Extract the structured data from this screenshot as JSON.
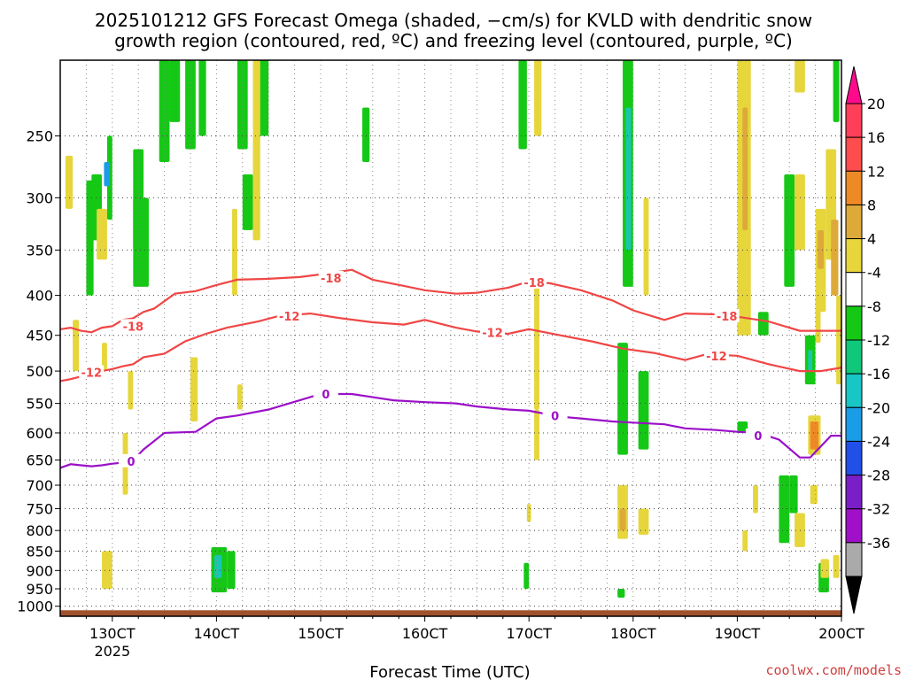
{
  "chart_data": {
    "type": "heatmap",
    "title_lines": [
      "2025101212 GFS Forecast Omega (shaded, −cm/s) for KVLD with dendritic snow",
      "growth region (contoured, red, ºC) and freezing level (contoured, purple, ºC)"
    ],
    "xlabel": "Forecast Time (UTC)",
    "credit": "coolwx.com/models",
    "x_range": [
      12.5,
      20.0
    ],
    "x_ticks": [
      {
        "x": 13,
        "label": "130CT",
        "sub": "2025"
      },
      {
        "x": 14,
        "label": "140CT",
        "sub": ""
      },
      {
        "x": 15,
        "label": "150CT",
        "sub": ""
      },
      {
        "x": 16,
        "label": "160CT",
        "sub": ""
      },
      {
        "x": 17,
        "label": "170CT",
        "sub": ""
      },
      {
        "x": 18,
        "label": "180CT",
        "sub": ""
      },
      {
        "x": 19,
        "label": "190CT",
        "sub": ""
      },
      {
        "x": 20,
        "label": "200CT",
        "sub": ""
      }
    ],
    "y_unit": "hPa",
    "y_log": true,
    "y_range": [
      1030,
      200
    ],
    "y_ticks": [
      250,
      300,
      350,
      400,
      450,
      500,
      550,
      600,
      650,
      700,
      750,
      800,
      850,
      900,
      950,
      1000
    ],
    "grid": true,
    "colorbar": {
      "labels": [
        20,
        16,
        12,
        8,
        4,
        -4,
        -8,
        -12,
        -16,
        -20,
        -24,
        -28,
        -32,
        -36
      ],
      "bins": [
        {
          "color": "#ff3f5a"
        },
        {
          "color": "#ff4d4d"
        },
        {
          "color": "#ee8a26"
        },
        {
          "color": "#ddaa3a"
        },
        {
          "color": "#e6d63c"
        },
        {
          "color": "#ffffff"
        },
        {
          "color": "#16c816"
        },
        {
          "color": "#10c77a"
        },
        {
          "color": "#18c6c6"
        },
        {
          "color": "#1a9de6"
        },
        {
          "color": "#2050e8"
        },
        {
          "color": "#7a1ec8"
        },
        {
          "color": "#a010c8"
        },
        {
          "color": "#aaaaaa"
        }
      ],
      "top_triangle_color": "#ff0a8c",
      "bottom_triangle_color": "#000000"
    },
    "omega_cells": [
      {
        "x0": 12.55,
        "x1": 12.62,
        "p0": 265,
        "p1": 310,
        "v": 4
      },
      {
        "x0": 12.75,
        "x1": 12.82,
        "p0": 285,
        "p1": 400,
        "v": -6
      },
      {
        "x0": 12.8,
        "x1": 12.9,
        "p0": 280,
        "p1": 340,
        "v": -6
      },
      {
        "x0": 12.85,
        "x1": 12.95,
        "p0": 310,
        "p1": 360,
        "v": 4
      },
      {
        "x0": 12.95,
        "x1": 13.0,
        "p0": 250,
        "p1": 320,
        "v": -6
      },
      {
        "x0": 12.92,
        "x1": 12.97,
        "p0": 270,
        "p1": 290,
        "v": -16
      },
      {
        "x0": 13.2,
        "x1": 13.3,
        "p0": 260,
        "p1": 350,
        "v": -6
      },
      {
        "x0": 13.2,
        "x1": 13.35,
        "p0": 300,
        "p1": 390,
        "v": -6
      },
      {
        "x0": 13.45,
        "x1": 13.55,
        "p0": 200,
        "p1": 270,
        "v": -6
      },
      {
        "x0": 13.55,
        "x1": 13.65,
        "p0": 200,
        "p1": 240,
        "v": -6
      },
      {
        "x0": 13.7,
        "x1": 13.8,
        "p0": 200,
        "p1": 260,
        "v": -6
      },
      {
        "x0": 13.83,
        "x1": 13.9,
        "p0": 200,
        "p1": 250,
        "v": -6
      },
      {
        "x0": 14.2,
        "x1": 14.3,
        "p0": 200,
        "p1": 260,
        "v": -6
      },
      {
        "x0": 14.25,
        "x1": 14.35,
        "p0": 280,
        "p1": 330,
        "v": -6
      },
      {
        "x0": 14.4,
        "x1": 14.5,
        "p0": 200,
        "p1": 250,
        "v": -6
      },
      {
        "x0": 15.4,
        "x1": 15.47,
        "p0": 230,
        "p1": 270,
        "v": -6
      },
      {
        "x0": 16.9,
        "x1": 16.98,
        "p0": 200,
        "p1": 260,
        "v": -6
      },
      {
        "x0": 17.05,
        "x1": 17.12,
        "p0": 200,
        "p1": 250,
        "v": 4
      },
      {
        "x0": 14.15,
        "x1": 14.2,
        "p0": 310,
        "p1": 400,
        "v": 4
      },
      {
        "x0": 14.35,
        "x1": 14.42,
        "p0": 200,
        "p1": 340,
        "v": 4
      },
      {
        "x0": 13.75,
        "x1": 13.82,
        "p0": 480,
        "p1": 580,
        "v": 4
      },
      {
        "x0": 13.1,
        "x1": 13.15,
        "p0": 600,
        "p1": 720,
        "v": 4
      },
      {
        "x0": 12.62,
        "x1": 12.68,
        "p0": 430,
        "p1": 500,
        "v": 4
      },
      {
        "x0": 12.9,
        "x1": 12.95,
        "p0": 460,
        "p1": 500,
        "v": 4
      },
      {
        "x0": 12.9,
        "x1": 13.0,
        "p0": 850,
        "p1": 950,
        "v": 4
      },
      {
        "x0": 13.15,
        "x1": 13.2,
        "p0": 500,
        "p1": 560,
        "v": 4
      },
      {
        "x0": 14.2,
        "x1": 14.25,
        "p0": 520,
        "p1": 560,
        "v": 4
      },
      {
        "x0": 17.05,
        "x1": 17.1,
        "p0": 380,
        "p1": 560,
        "v": 4
      },
      {
        "x0": 17.05,
        "x1": 17.1,
        "p0": 560,
        "p1": 650,
        "v": 4
      },
      {
        "x0": 16.98,
        "x1": 17.02,
        "p0": 740,
        "p1": 780,
        "v": 4
      },
      {
        "x0": 13.95,
        "x1": 14.1,
        "p0": 840,
        "p1": 960,
        "v": -6
      },
      {
        "x0": 13.98,
        "x1": 14.05,
        "p0": 860,
        "p1": 920,
        "v": -10
      },
      {
        "x0": 14.1,
        "x1": 14.18,
        "p0": 850,
        "p1": 950,
        "v": -6
      },
      {
        "x0": 16.95,
        "x1": 17.0,
        "p0": 880,
        "p1": 950,
        "v": -6
      },
      {
        "x0": 17.9,
        "x1": 18.0,
        "p0": 200,
        "p1": 390,
        "v": -6
      },
      {
        "x0": 17.93,
        "x1": 17.98,
        "p0": 230,
        "p1": 350,
        "v": -10
      },
      {
        "x0": 18.1,
        "x1": 18.15,
        "p0": 300,
        "p1": 400,
        "v": 4
      },
      {
        "x0": 17.85,
        "x1": 17.95,
        "p0": 460,
        "p1": 640,
        "v": -6
      },
      {
        "x0": 18.05,
        "x1": 18.15,
        "p0": 500,
        "p1": 630,
        "v": -6
      },
      {
        "x0": 17.85,
        "x1": 17.95,
        "p0": 700,
        "p1": 820,
        "v": 4
      },
      {
        "x0": 17.87,
        "x1": 17.93,
        "p0": 750,
        "p1": 800,
        "v": 8
      },
      {
        "x0": 18.05,
        "x1": 18.15,
        "p0": 750,
        "p1": 810,
        "v": 4
      },
      {
        "x0": 17.85,
        "x1": 17.92,
        "p0": 950,
        "p1": 975,
        "v": -6
      },
      {
        "x0": 19.0,
        "x1": 19.13,
        "p0": 200,
        "p1": 450,
        "v": 4
      },
      {
        "x0": 19.05,
        "x1": 19.1,
        "p0": 230,
        "p1": 330,
        "v": 8
      },
      {
        "x0": 19.2,
        "x1": 19.3,
        "p0": 420,
        "p1": 450,
        "v": -6
      },
      {
        "x0": 19.0,
        "x1": 19.1,
        "p0": 580,
        "p1": 600,
        "v": -6
      },
      {
        "x0": 19.15,
        "x1": 19.2,
        "p0": 700,
        "p1": 760,
        "v": 4
      },
      {
        "x0": 19.05,
        "x1": 19.1,
        "p0": 800,
        "p1": 850,
        "v": 4
      },
      {
        "x0": 19.45,
        "x1": 19.55,
        "p0": 280,
        "p1": 390,
        "v": -6
      },
      {
        "x0": 19.55,
        "x1": 19.65,
        "p0": 280,
        "p1": 350,
        "v": 4
      },
      {
        "x0": 19.55,
        "x1": 19.65,
        "p0": 200,
        "p1": 220,
        "v": 4
      },
      {
        "x0": 19.75,
        "x1": 19.85,
        "p0": 310,
        "p1": 420,
        "v": 4
      },
      {
        "x0": 19.77,
        "x1": 19.83,
        "p0": 330,
        "p1": 370,
        "v": 8
      },
      {
        "x0": 19.85,
        "x1": 19.95,
        "p0": 260,
        "p1": 360,
        "v": 4
      },
      {
        "x0": 19.9,
        "x1": 19.97,
        "p0": 320,
        "p1": 400,
        "v": 8
      },
      {
        "x0": 19.92,
        "x1": 19.98,
        "p0": 200,
        "p1": 240,
        "v": -6
      },
      {
        "x0": 19.65,
        "x1": 19.75,
        "p0": 450,
        "p1": 520,
        "v": -6
      },
      {
        "x0": 19.68,
        "x1": 19.72,
        "p0": 470,
        "p1": 500,
        "v": -10
      },
      {
        "x0": 19.75,
        "x1": 19.8,
        "p0": 400,
        "p1": 460,
        "v": 4
      },
      {
        "x0": 19.95,
        "x1": 20.0,
        "p0": 400,
        "p1": 520,
        "v": 4
      },
      {
        "x0": 19.68,
        "x1": 19.8,
        "p0": 570,
        "p1": 640,
        "v": 4
      },
      {
        "x0": 19.7,
        "x1": 19.78,
        "p0": 580,
        "p1": 630,
        "v": 12
      },
      {
        "x0": 19.4,
        "x1": 19.5,
        "p0": 680,
        "p1": 830,
        "v": -6
      },
      {
        "x0": 19.5,
        "x1": 19.58,
        "p0": 680,
        "p1": 760,
        "v": -6
      },
      {
        "x0": 19.55,
        "x1": 19.65,
        "p0": 760,
        "p1": 840,
        "v": 4
      },
      {
        "x0": 19.7,
        "x1": 19.77,
        "p0": 700,
        "p1": 740,
        "v": 4
      },
      {
        "x0": 19.78,
        "x1": 19.88,
        "p0": 880,
        "p1": 960,
        "v": -6
      },
      {
        "x0": 19.8,
        "x1": 19.88,
        "p0": 870,
        "p1": 920,
        "v": 4
      },
      {
        "x0": 19.92,
        "x1": 19.98,
        "p0": 860,
        "p1": 920,
        "v": 4
      }
    ],
    "series": [
      {
        "name": "-18",
        "color": "#f04646",
        "x": [
          12.5,
          12.6,
          12.7,
          12.8,
          12.9,
          13.0,
          13.1,
          13.2,
          13.3,
          13.4,
          13.6,
          13.8,
          14.0,
          14.2,
          14.5,
          14.8,
          15.0,
          15.3,
          15.5,
          15.8,
          16.0,
          16.3,
          16.5,
          16.8,
          17.0,
          17.2,
          17.5,
          17.8,
          18.0,
          18.3,
          18.5,
          18.8,
          19.0,
          19.3,
          19.6,
          19.8,
          20.0
        ],
        "y": [
          442,
          440,
          444,
          446,
          440,
          438,
          430,
          428,
          420,
          416,
          398,
          395,
          388,
          382,
          381,
          379,
          376,
          371,
          382,
          389,
          394,
          398,
          397,
          391,
          384,
          386,
          394,
          406,
          418,
          430,
          422,
          423,
          426,
          432,
          444,
          444,
          444
        ]
      },
      {
        "name": "-12",
        "color": "#f04646",
        "x": [
          12.5,
          12.6,
          12.7,
          12.8,
          12.9,
          13.0,
          13.1,
          13.2,
          13.3,
          13.5,
          13.7,
          13.9,
          14.1,
          14.4,
          14.6,
          14.9,
          15.2,
          15.5,
          15.8,
          16.0,
          16.3,
          16.5,
          16.8,
          17.0,
          17.3,
          17.6,
          17.9,
          18.2,
          18.5,
          18.7,
          19.0,
          19.3,
          19.6,
          19.8,
          20.0
        ],
        "y": [
          515,
          512,
          508,
          505,
          500,
          497,
          493,
          490,
          480,
          475,
          458,
          448,
          440,
          432,
          425,
          422,
          428,
          433,
          436,
          430,
          440,
          445,
          448,
          442,
          450,
          458,
          468,
          474,
          484,
          476,
          478,
          490,
          500,
          500,
          495
        ]
      },
      {
        "name": "0",
        "color": "#9a10c8",
        "x": [
          12.5,
          12.6,
          12.7,
          12.8,
          12.9,
          13.0,
          13.1,
          13.2,
          13.3,
          13.5,
          13.8,
          14.0,
          14.2,
          14.5,
          14.7,
          15.0,
          15.3,
          15.5,
          15.7,
          16.0,
          16.3,
          16.5,
          16.8,
          17.0,
          17.3,
          17.5,
          17.8,
          18.0,
          18.3,
          18.5,
          18.8,
          19.0,
          19.2,
          19.4,
          19.6,
          19.7,
          19.9,
          20.0
        ],
        "y": [
          665,
          658,
          660,
          662,
          660,
          657,
          655,
          650,
          630,
          600,
          598,
          575,
          570,
          560,
          550,
          535,
          535,
          540,
          545,
          548,
          550,
          555,
          560,
          562,
          572,
          575,
          580,
          582,
          585,
          592,
          595,
          598,
          600,
          612,
          645,
          645,
          605,
          605
        ]
      }
    ],
    "contour_labels": [
      {
        "text": "-18",
        "x": 13.2,
        "p": 438,
        "color": "#f04646"
      },
      {
        "text": "-18",
        "x": 15.1,
        "p": 380,
        "color": "#f04646"
      },
      {
        "text": "-18",
        "x": 17.05,
        "p": 385,
        "color": "#f04646"
      },
      {
        "text": "-18",
        "x": 18.9,
        "p": 425,
        "color": "#f04646"
      },
      {
        "text": "-12",
        "x": 12.8,
        "p": 502,
        "color": "#f04646"
      },
      {
        "text": "-12",
        "x": 14.7,
        "p": 425,
        "color": "#f04646"
      },
      {
        "text": "-12",
        "x": 16.65,
        "p": 446,
        "color": "#f04646"
      },
      {
        "text": "-12",
        "x": 18.8,
        "p": 478,
        "color": "#f04646"
      },
      {
        "text": "0",
        "x": 13.18,
        "p": 652,
        "color": "#9a10c8"
      },
      {
        "text": "0",
        "x": 15.05,
        "p": 535,
        "color": "#9a10c8"
      },
      {
        "text": "0",
        "x": 17.25,
        "p": 570,
        "color": "#9a10c8"
      },
      {
        "text": "0",
        "x": 19.2,
        "p": 605,
        "color": "#9a10c8"
      }
    ],
    "terrain_color": "#a0522d"
  }
}
